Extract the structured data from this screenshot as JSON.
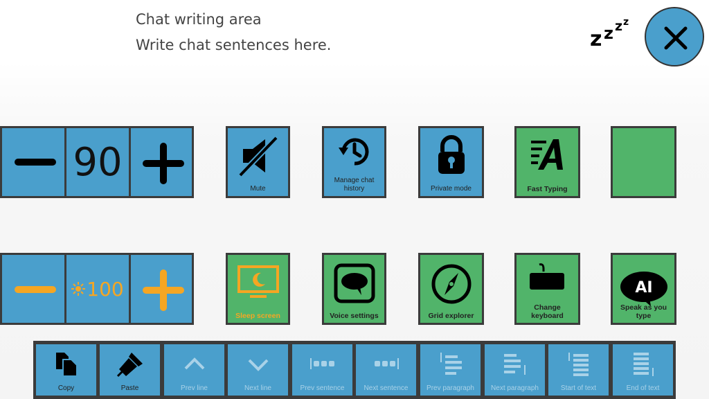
{
  "chat": {
    "title": "Chat writing area",
    "placeholder": "Write chat sentences here."
  },
  "header": {
    "sleep_icon": "zzz-icon",
    "close_icon": "close-icon"
  },
  "volume": {
    "minus": "minus-icon",
    "value": "90",
    "plus": "plus-icon"
  },
  "brightness": {
    "minus": "minus-icon",
    "value": "100",
    "plus": "plus-icon",
    "sun_glyph": "sun-icon",
    "color": "#f5a623"
  },
  "row1": [
    {
      "label": "Mute",
      "icon": "mute-icon"
    },
    {
      "label": "Manage chat history",
      "icon": "history-icon"
    },
    {
      "label": "Private mode",
      "icon": "lock-icon"
    },
    {
      "label": "Fast Typing",
      "icon": "fast-typing-icon"
    },
    {
      "label": "",
      "icon": ""
    }
  ],
  "row2": [
    {
      "label": "Sleep screen",
      "icon": "sleep-screen-icon"
    },
    {
      "label": "Voice settings",
      "icon": "speech-bubble-icon"
    },
    {
      "label": "Grid explorer",
      "icon": "compass-icon"
    },
    {
      "label": "Change keyboard",
      "icon": "keyboard-icon"
    },
    {
      "label": "Speak as you type",
      "icon": "ai-bubble-icon"
    }
  ],
  "bottom": [
    {
      "label": "Copy",
      "icon": "copy-icon"
    },
    {
      "label": "Paste",
      "icon": "paste-brush-icon"
    },
    {
      "label": "Prev line",
      "icon": "chevron-up-icon"
    },
    {
      "label": "Next line",
      "icon": "chevron-down-icon"
    },
    {
      "label": "Prev sentence",
      "icon": "prev-sentence-icon"
    },
    {
      "label": "Next sentence",
      "icon": "next-sentence-icon"
    },
    {
      "label": "Prev paragraph",
      "icon": "prev-paragraph-icon"
    },
    {
      "label": "Next paragraph",
      "icon": "next-paragraph-icon"
    },
    {
      "label": "Start of text",
      "icon": "start-of-text-icon"
    },
    {
      "label": "End of text",
      "icon": "end-of-text-icon"
    }
  ],
  "colors": {
    "tile_blue": "#4a9fcc",
    "tile_green": "#51b46a",
    "border": "#3b3b3b",
    "accent_orange": "#f5a623"
  }
}
